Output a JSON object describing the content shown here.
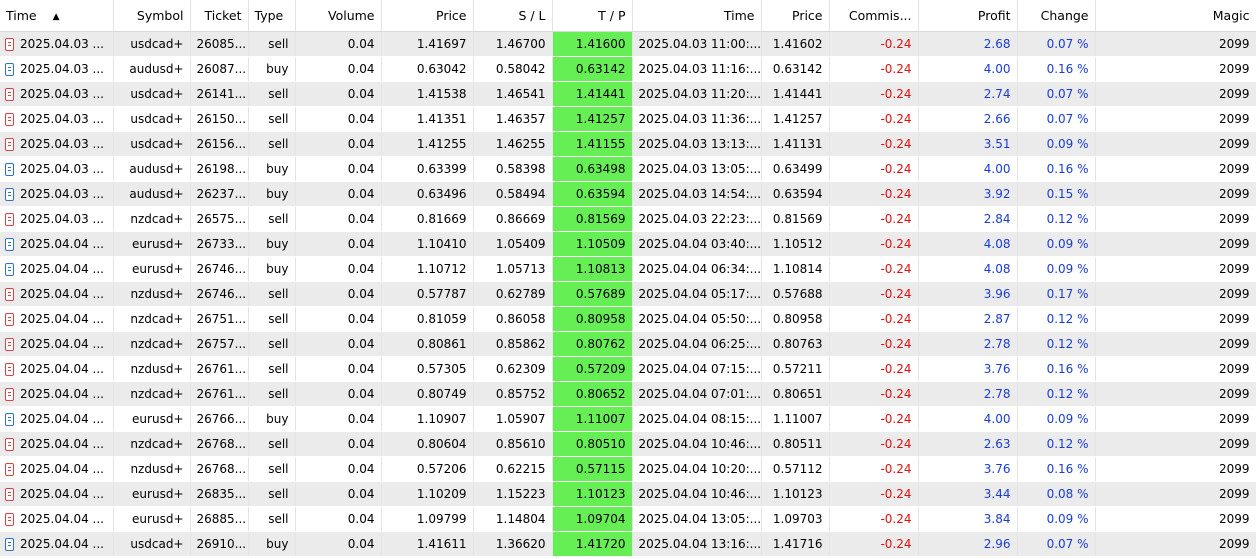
{
  "columns": [
    "Time",
    "Symbol",
    "Ticket",
    "Type",
    "Volume",
    "Price",
    "S / L",
    "T / P",
    "Time",
    "Price",
    "Commis...",
    "Profit",
    "Change",
    "Magic"
  ],
  "sort_indicator": "▲",
  "colors": {
    "tp_highlight": "#66ee55",
    "negative": "#e01010",
    "positive_blue": "#1a3cd6",
    "row_alt": "#ebebeb"
  },
  "rows": [
    {
      "time": "2025.04.03 ...",
      "symbol": "usdcad+",
      "ticket": "26085...",
      "type": "sell",
      "volume": "0.04",
      "price": "1.41697",
      "sl": "1.46700",
      "tp": "1.41600",
      "ctime": "2025.04.03 11:00:...",
      "cprice": "1.41602",
      "commission": "-0.24",
      "profit": "2.68",
      "change": "0.07 %",
      "magic": "2099"
    },
    {
      "time": "2025.04.03 ...",
      "symbol": "audusd+",
      "ticket": "26087...",
      "type": "buy",
      "volume": "0.04",
      "price": "0.63042",
      "sl": "0.58042",
      "tp": "0.63142",
      "ctime": "2025.04.03 11:16:...",
      "cprice": "0.63142",
      "commission": "-0.24",
      "profit": "4.00",
      "change": "0.16 %",
      "magic": "2099"
    },
    {
      "time": "2025.04.03 ...",
      "symbol": "usdcad+",
      "ticket": "26141...",
      "type": "sell",
      "volume": "0.04",
      "price": "1.41538",
      "sl": "1.46541",
      "tp": "1.41441",
      "ctime": "2025.04.03 11:20:...",
      "cprice": "1.41441",
      "commission": "-0.24",
      "profit": "2.74",
      "change": "0.07 %",
      "magic": "2099"
    },
    {
      "time": "2025.04.03 ...",
      "symbol": "usdcad+",
      "ticket": "26150...",
      "type": "sell",
      "volume": "0.04",
      "price": "1.41351",
      "sl": "1.46357",
      "tp": "1.41257",
      "ctime": "2025.04.03 11:36:...",
      "cprice": "1.41257",
      "commission": "-0.24",
      "profit": "2.66",
      "change": "0.07 %",
      "magic": "2099"
    },
    {
      "time": "2025.04.03 ...",
      "symbol": "usdcad+",
      "ticket": "26156...",
      "type": "sell",
      "volume": "0.04",
      "price": "1.41255",
      "sl": "1.46255",
      "tp": "1.41155",
      "ctime": "2025.04.03 13:13:...",
      "cprice": "1.41131",
      "commission": "-0.24",
      "profit": "3.51",
      "change": "0.09 %",
      "magic": "2099"
    },
    {
      "time": "2025.04.03 ...",
      "symbol": "audusd+",
      "ticket": "26198...",
      "type": "buy",
      "volume": "0.04",
      "price": "0.63399",
      "sl": "0.58398",
      "tp": "0.63498",
      "ctime": "2025.04.03 13:05:...",
      "cprice": "0.63499",
      "commission": "-0.24",
      "profit": "4.00",
      "change": "0.16 %",
      "magic": "2099"
    },
    {
      "time": "2025.04.03 ...",
      "symbol": "audusd+",
      "ticket": "26237...",
      "type": "buy",
      "volume": "0.04",
      "price": "0.63496",
      "sl": "0.58494",
      "tp": "0.63594",
      "ctime": "2025.04.03 14:54:...",
      "cprice": "0.63594",
      "commission": "-0.24",
      "profit": "3.92",
      "change": "0.15 %",
      "magic": "2099"
    },
    {
      "time": "2025.04.03 ...",
      "symbol": "nzdcad+",
      "ticket": "26575...",
      "type": "sell",
      "volume": "0.04",
      "price": "0.81669",
      "sl": "0.86669",
      "tp": "0.81569",
      "ctime": "2025.04.03 22:23:...",
      "cprice": "0.81569",
      "commission": "-0.24",
      "profit": "2.84",
      "change": "0.12 %",
      "magic": "2099"
    },
    {
      "time": "2025.04.04 ...",
      "symbol": "eurusd+",
      "ticket": "26733...",
      "type": "buy",
      "volume": "0.04",
      "price": "1.10410",
      "sl": "1.05409",
      "tp": "1.10509",
      "ctime": "2025.04.04 03:40:...",
      "cprice": "1.10512",
      "commission": "-0.24",
      "profit": "4.08",
      "change": "0.09 %",
      "magic": "2099"
    },
    {
      "time": "2025.04.04 ...",
      "symbol": "eurusd+",
      "ticket": "26746...",
      "type": "buy",
      "volume": "0.04",
      "price": "1.10712",
      "sl": "1.05713",
      "tp": "1.10813",
      "ctime": "2025.04.04 06:34:...",
      "cprice": "1.10814",
      "commission": "-0.24",
      "profit": "4.08",
      "change": "0.09 %",
      "magic": "2099"
    },
    {
      "time": "2025.04.04 ...",
      "symbol": "nzdusd+",
      "ticket": "26746...",
      "type": "sell",
      "volume": "0.04",
      "price": "0.57787",
      "sl": "0.62789",
      "tp": "0.57689",
      "ctime": "2025.04.04 05:17:...",
      "cprice": "0.57688",
      "commission": "-0.24",
      "profit": "3.96",
      "change": "0.17 %",
      "magic": "2099"
    },
    {
      "time": "2025.04.04 ...",
      "symbol": "nzdcad+",
      "ticket": "26751...",
      "type": "sell",
      "volume": "0.04",
      "price": "0.81059",
      "sl": "0.86058",
      "tp": "0.80958",
      "ctime": "2025.04.04 05:50:...",
      "cprice": "0.80958",
      "commission": "-0.24",
      "profit": "2.87",
      "change": "0.12 %",
      "magic": "2099"
    },
    {
      "time": "2025.04.04 ...",
      "symbol": "nzdcad+",
      "ticket": "26757...",
      "type": "sell",
      "volume": "0.04",
      "price": "0.80861",
      "sl": "0.85862",
      "tp": "0.80762",
      "ctime": "2025.04.04 06:25:...",
      "cprice": "0.80763",
      "commission": "-0.24",
      "profit": "2.78",
      "change": "0.12 %",
      "magic": "2099"
    },
    {
      "time": "2025.04.04 ...",
      "symbol": "nzdusd+",
      "ticket": "26761...",
      "type": "sell",
      "volume": "0.04",
      "price": "0.57305",
      "sl": "0.62309",
      "tp": "0.57209",
      "ctime": "2025.04.04 07:15:...",
      "cprice": "0.57211",
      "commission": "-0.24",
      "profit": "3.76",
      "change": "0.16 %",
      "magic": "2099"
    },
    {
      "time": "2025.04.04 ...",
      "symbol": "nzdcad+",
      "ticket": "26761...",
      "type": "sell",
      "volume": "0.04",
      "price": "0.80749",
      "sl": "0.85752",
      "tp": "0.80652",
      "ctime": "2025.04.04 07:01:...",
      "cprice": "0.80651",
      "commission": "-0.24",
      "profit": "2.78",
      "change": "0.12 %",
      "magic": "2099"
    },
    {
      "time": "2025.04.04 ...",
      "symbol": "eurusd+",
      "ticket": "26766...",
      "type": "buy",
      "volume": "0.04",
      "price": "1.10907",
      "sl": "1.05907",
      "tp": "1.11007",
      "ctime": "2025.04.04 08:15:...",
      "cprice": "1.11007",
      "commission": "-0.24",
      "profit": "4.00",
      "change": "0.09 %",
      "magic": "2099"
    },
    {
      "time": "2025.04.04 ...",
      "symbol": "nzdcad+",
      "ticket": "26768...",
      "type": "sell",
      "volume": "0.04",
      "price": "0.80604",
      "sl": "0.85610",
      "tp": "0.80510",
      "ctime": "2025.04.04 10:46:...",
      "cprice": "0.80511",
      "commission": "-0.24",
      "profit": "2.63",
      "change": "0.12 %",
      "magic": "2099"
    },
    {
      "time": "2025.04.04 ...",
      "symbol": "nzdusd+",
      "ticket": "26768...",
      "type": "sell",
      "volume": "0.04",
      "price": "0.57206",
      "sl": "0.62215",
      "tp": "0.57115",
      "ctime": "2025.04.04 10:20:...",
      "cprice": "0.57112",
      "commission": "-0.24",
      "profit": "3.76",
      "change": "0.16 %",
      "magic": "2099"
    },
    {
      "time": "2025.04.04 ...",
      "symbol": "eurusd+",
      "ticket": "26835...",
      "type": "sell",
      "volume": "0.04",
      "price": "1.10209",
      "sl": "1.15223",
      "tp": "1.10123",
      "ctime": "2025.04.04 10:46:...",
      "cprice": "1.10123",
      "commission": "-0.24",
      "profit": "3.44",
      "change": "0.08 %",
      "magic": "2099"
    },
    {
      "time": "2025.04.04 ...",
      "symbol": "eurusd+",
      "ticket": "26885...",
      "type": "sell",
      "volume": "0.04",
      "price": "1.09799",
      "sl": "1.14804",
      "tp": "1.09704",
      "ctime": "2025.04.04 13:05:...",
      "cprice": "1.09703",
      "commission": "-0.24",
      "profit": "3.84",
      "change": "0.09 %",
      "magic": "2099"
    },
    {
      "time": "2025.04.04 ...",
      "symbol": "usdcad+",
      "ticket": "26910...",
      "type": "buy",
      "volume": "0.04",
      "price": "1.41611",
      "sl": "1.36620",
      "tp": "1.41720",
      "ctime": "2025.04.04 13:16:...",
      "cprice": "1.41716",
      "commission": "-0.24",
      "profit": "2.96",
      "change": "0.07 %",
      "magic": "2099"
    }
  ]
}
